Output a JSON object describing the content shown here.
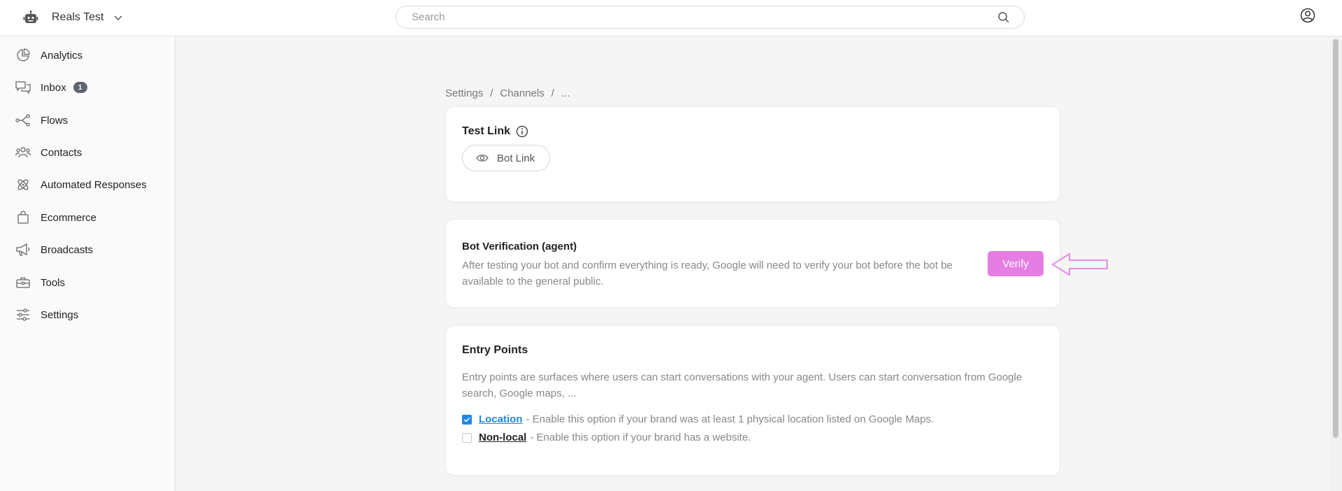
{
  "header": {
    "app_name": "Reals Test",
    "search_placeholder": "Search"
  },
  "sidebar": {
    "items": [
      {
        "label": "Analytics",
        "icon": "analytics-icon"
      },
      {
        "label": "Inbox",
        "icon": "inbox-icon",
        "badge": "1"
      },
      {
        "label": "Flows",
        "icon": "flows-icon"
      },
      {
        "label": "Contacts",
        "icon": "contacts-icon"
      },
      {
        "label": "Automated Responses",
        "icon": "automated-responses-icon"
      },
      {
        "label": "Ecommerce",
        "icon": "shopping-bag-icon"
      },
      {
        "label": "Broadcasts",
        "icon": "megaphone-icon"
      },
      {
        "label": "Tools",
        "icon": "toolbox-icon"
      },
      {
        "label": "Settings",
        "icon": "sliders-icon"
      }
    ]
  },
  "breadcrumb": {
    "items": [
      "Settings",
      "Channels",
      "..."
    ],
    "separator": "/"
  },
  "test_link": {
    "title": "Test Link",
    "button_label": "Bot Link"
  },
  "verification": {
    "title": "Bot Verification (agent)",
    "description": "After testing your bot and confirm everything is ready, Google will need to verify your bot before the bot be available to the general public.",
    "button_label": "Verify"
  },
  "entry_points": {
    "title": "Entry Points",
    "description": "Entry points are surfaces where users can start conversations with your agent. Users can start conversation from Google search, Google maps, ...",
    "options": [
      {
        "label": "Location",
        "text": "- Enable this option if your brand was at least 1 physical location listed on Google Maps.",
        "checked": true
      },
      {
        "label": "Non-local",
        "text": "- Enable this option if your brand has a website.",
        "checked": false
      }
    ]
  },
  "colors": {
    "accent": "#e57ee3",
    "link": "#1e88e5",
    "badge": "#5e6470"
  }
}
